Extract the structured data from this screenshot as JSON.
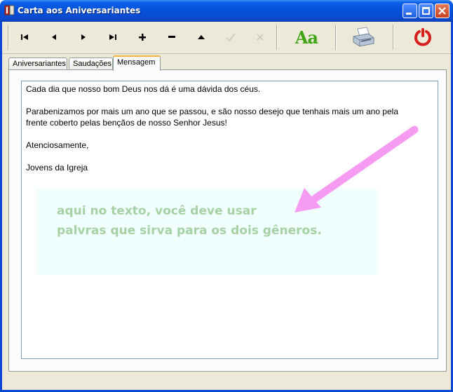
{
  "window": {
    "title": "Carta aos Aniversariantes"
  },
  "toolbar": {
    "buttons": [
      {
        "name": "first-record-button",
        "icon": "first-icon",
        "symbol": "|◄"
      },
      {
        "name": "prior-record-button",
        "icon": "prior-icon",
        "symbol": "◄"
      },
      {
        "name": "next-record-button",
        "icon": "next-icon",
        "symbol": "►"
      },
      {
        "name": "last-record-button",
        "icon": "last-icon",
        "symbol": "►|"
      },
      {
        "name": "insert-button",
        "icon": "plus-icon",
        "symbol": "+"
      },
      {
        "name": "delete-button",
        "icon": "minus-icon",
        "symbol": "−"
      },
      {
        "name": "edit-button",
        "icon": "up-triangle-icon",
        "symbol": "▲"
      },
      {
        "name": "post-button",
        "icon": "check-icon",
        "symbol": "✓"
      },
      {
        "name": "cancel-button",
        "icon": "cross-icon",
        "symbol": "✕"
      }
    ],
    "font_button_label": "Aa",
    "print_icon": "printer-icon",
    "exit_icon": "power-icon"
  },
  "tabs": [
    {
      "label": "Aniversariantes",
      "active": false
    },
    {
      "label": "Saudações",
      "active": false
    },
    {
      "label": "Mensagem",
      "active": true
    }
  ],
  "memo": {
    "lines": [
      "Cada dia que nosso bom Deus nos dá é uma dávida dos céus.",
      "Parabenizamos por mais um ano que se passou, e são nosso desejo que tenhais mais um ano pela",
      "frente coberto pelas bençãos de nosso Senhor Jesus!",
      "Atenciosamente,",
      "Jovens da Igreja"
    ]
  },
  "annotation": {
    "lines": [
      "aqui no texto, você deve usar",
      "palvras que sirva para os dois gêneros."
    ],
    "text_color": "#a6d1a4",
    "arrow_color": "#f59cf2"
  }
}
